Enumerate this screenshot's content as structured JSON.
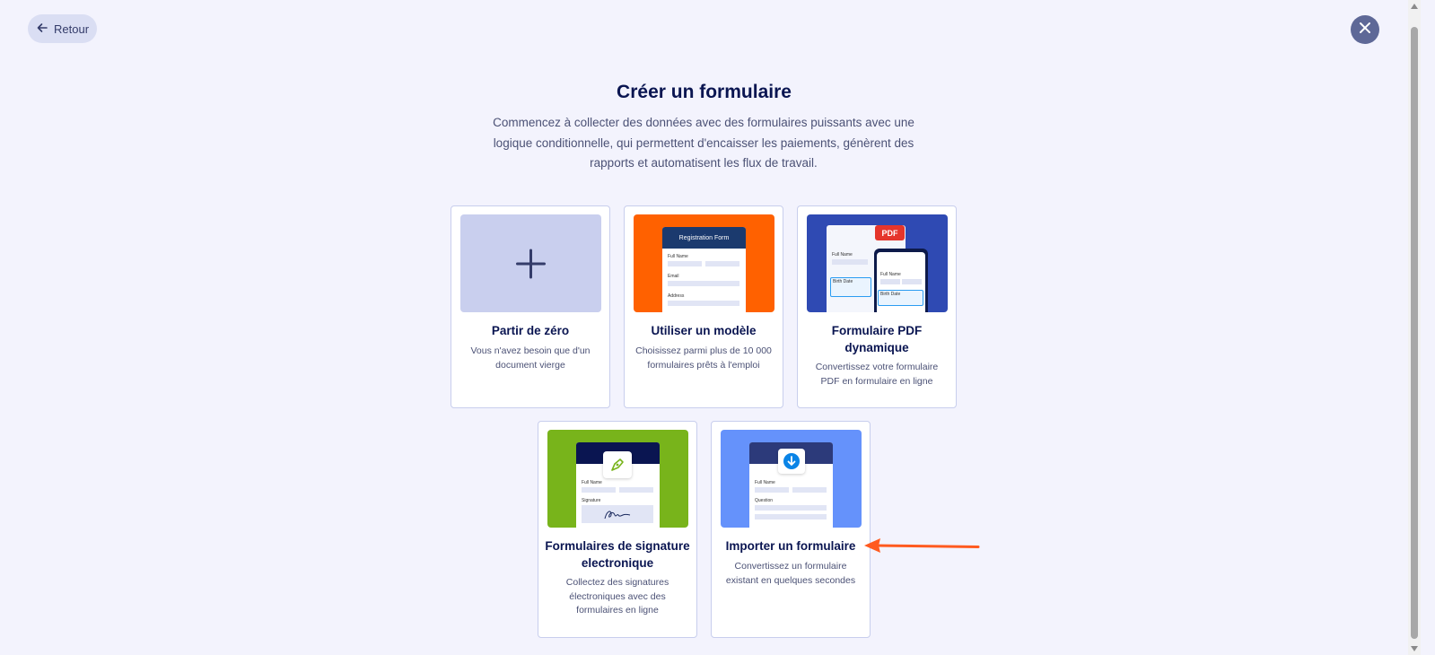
{
  "header": {
    "back_label": "Retour"
  },
  "main": {
    "title": "Créer un formulaire",
    "subtitle": "Commencez à collecter des données avec des formulaires puissants avec une logique conditionnelle, qui permettent d'encaisser les paiements, génèrent des rapports et automatisent les flux de travail."
  },
  "cards": [
    {
      "title": "Partir de zéro",
      "description": "Vous n'avez besoin que d'un document vierge"
    },
    {
      "title": "Utiliser un modèle",
      "description": "Choisissez parmi plus de 10 000 formulaires prêts à l'emploi"
    },
    {
      "title": "Formulaire PDF dynamique",
      "description": "Convertissez votre formulaire PDF en formulaire en ligne"
    },
    {
      "title": "Formulaires de signature electronique",
      "description": "Collectez des signatures électroniques avec des formulaires en ligne"
    },
    {
      "title": "Importer un formulaire",
      "description": "Convertissez un formulaire existant en quelques secondes"
    }
  ],
  "thumbs": {
    "template": {
      "form_title": "Registration Form",
      "field1": "Full Name",
      "field2": "Email",
      "field3": "Address"
    },
    "pdf": {
      "badge": "PDF",
      "field1": "Full Name",
      "field2": "Birth Date",
      "phone_field1": "Full Name",
      "phone_field2": "Birth Date"
    },
    "signature": {
      "field1": "Full Name",
      "field2": "Signature"
    },
    "import": {
      "field1": "Full Name",
      "field2": "Question"
    }
  },
  "colors": {
    "background": "#f3f3fd",
    "accent_orange": "#ff6100",
    "pdf_blue": "#2f4ab3",
    "sign_green": "#78b41b",
    "import_blue": "#6592fb",
    "blank_purple": "#c9cfee",
    "annotation_arrow": "#ff5a1f"
  }
}
